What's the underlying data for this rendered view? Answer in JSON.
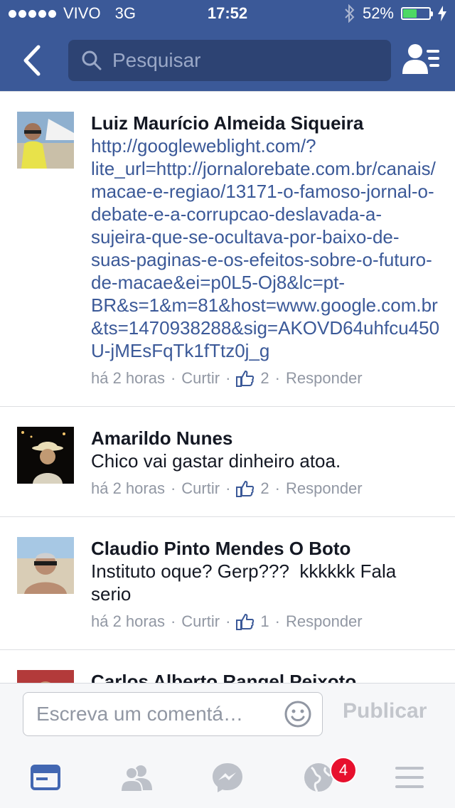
{
  "status_bar": {
    "carrier": "VIVO",
    "network": "3G",
    "time": "17:52",
    "battery": "52%",
    "battery_level": 0.52
  },
  "header": {
    "search_placeholder": "Pesquisar"
  },
  "comments": [
    {
      "author": "Luiz Maurício Almeida Siqueira",
      "text": "http://googleweblight.com/?lite_url=http://jornalorebate.com.br/canais/macae-e-regiao/13171-o-famoso-jornal-o-debate-e-a-corrupcao-deslavada-a-sujeira-que-se-ocultava-por-baixo-de-suas-paginas-e-os-efeitos-sobre-o-futuro-de-macae&ei=p0L5-Oj8&lc=pt-BR&s=1&m=81&host=www.google.com.br&ts=1470938288&sig=AKOVD64uhfcu450U-jMEsFqTk1fTtz0j_g",
      "is_link": true,
      "time": "há 2 horas",
      "like_label": "Curtir",
      "likes": "2",
      "reply_label": "Responder"
    },
    {
      "author": "Amarildo Nunes",
      "text": "Chico vai gastar dinheiro atoa.",
      "is_link": false,
      "time": "há 2 horas",
      "like_label": "Curtir",
      "likes": "2",
      "reply_label": "Responder"
    },
    {
      "author": "Claudio Pinto Mendes O Boto",
      "text": "Instituto oque? Gerp???  kkkkkk Fala serio",
      "is_link": false,
      "time": "há 2 horas",
      "like_label": "Curtir",
      "likes": "1",
      "reply_label": "Responder"
    },
    {
      "author": "Carlos Alberto Rangel Peixoto",
      "text": "",
      "is_link": false,
      "time": "",
      "like_label": "",
      "likes": "",
      "reply_label": ""
    }
  ],
  "composer": {
    "placeholder": "Escreva um comentá…",
    "publish_label": "Publicar"
  },
  "tabbar": {
    "notifications_badge": "4"
  },
  "colors": {
    "brand": "#3b5998",
    "badge": "#e7102d",
    "active_tab": "#4267b2",
    "inactive_tab": "#bdc1c9"
  }
}
